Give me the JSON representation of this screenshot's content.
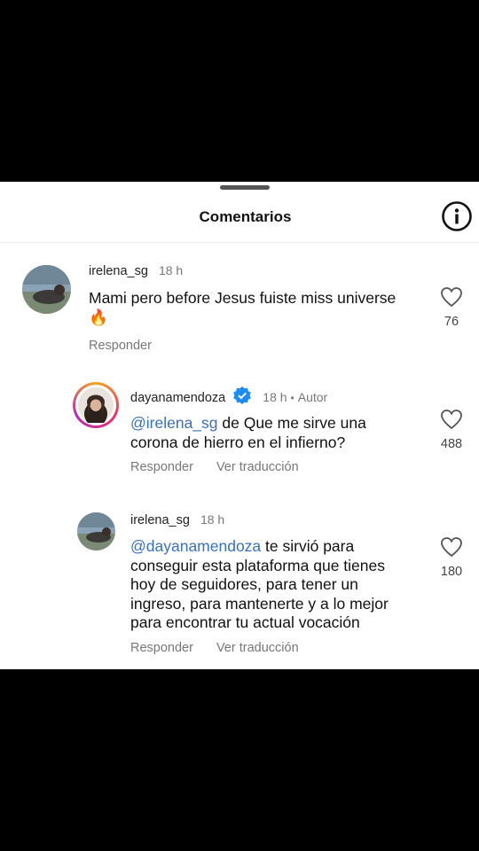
{
  "header": {
    "title": "Comentarios"
  },
  "comments": [
    {
      "username": "irelena_sg",
      "time": "18 h",
      "text": "Mami pero before Jesus fuiste miss universe",
      "emoji": "🔥",
      "reply_label": "Responder",
      "likes": "76"
    },
    {
      "username": "dayanamendoza",
      "time": "18 h",
      "author_label": "Autor",
      "mention": "@irelena_sg",
      "text_line1": " de Que me sirve una",
      "text_line2": "corona de hierro en el infierno?",
      "reply_label": "Responder",
      "translate_label": "Ver traducción",
      "likes": "488"
    },
    {
      "username": "irelena_sg",
      "time": "18 h",
      "mention": "@dayanamendoza",
      "text_line1": " te sirvió para",
      "text_lines": [
        "conseguir esta plataforma que tienes",
        "hoy de seguidores, para tener un",
        "ingreso, para mantenerte y a lo mejor",
        "para encontrar tu actual vocación"
      ],
      "reply_label": "Responder",
      "translate_label": "Ver traducción",
      "likes": "180"
    }
  ],
  "colors": {
    "mention": "#3b6fb6",
    "verified": "#1d8cf0",
    "background": "#000000"
  }
}
